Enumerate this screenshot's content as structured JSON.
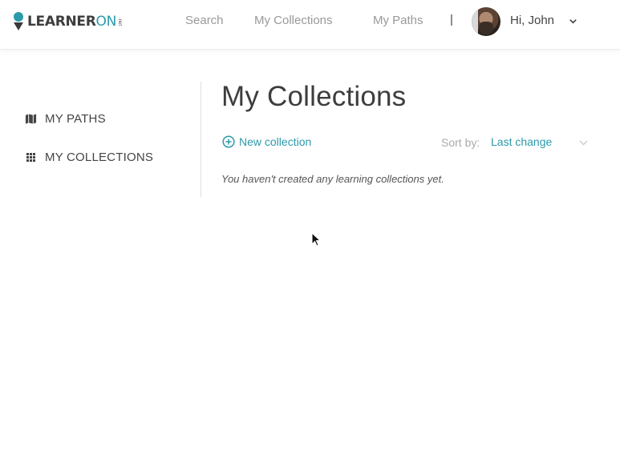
{
  "header": {
    "logo": {
      "text_main": "LEARNER",
      "text_accent": "ON",
      "text_suffix": ".net"
    },
    "nav": [
      {
        "label": "Search"
      },
      {
        "label": "My Collections"
      },
      {
        "label": "My Paths"
      }
    ],
    "separator": "|",
    "user": {
      "greeting": "Hi, John",
      "avatar_icon": "user-avatar",
      "menu_icon": "chevron-down-icon"
    }
  },
  "sidebar": {
    "items": [
      {
        "label": "MY PATHS",
        "icon": "map-icon"
      },
      {
        "label": "MY COLLECTIONS",
        "icon": "grid-icon"
      }
    ]
  },
  "main": {
    "title": "My Collections",
    "new_collection_label": "New collection",
    "sort": {
      "label": "Sort by:",
      "value": "Last change"
    },
    "empty_message": "You haven't created any learning collections yet."
  },
  "colors": {
    "accent": "#2b9aab",
    "text": "#444444",
    "muted": "#999999"
  }
}
